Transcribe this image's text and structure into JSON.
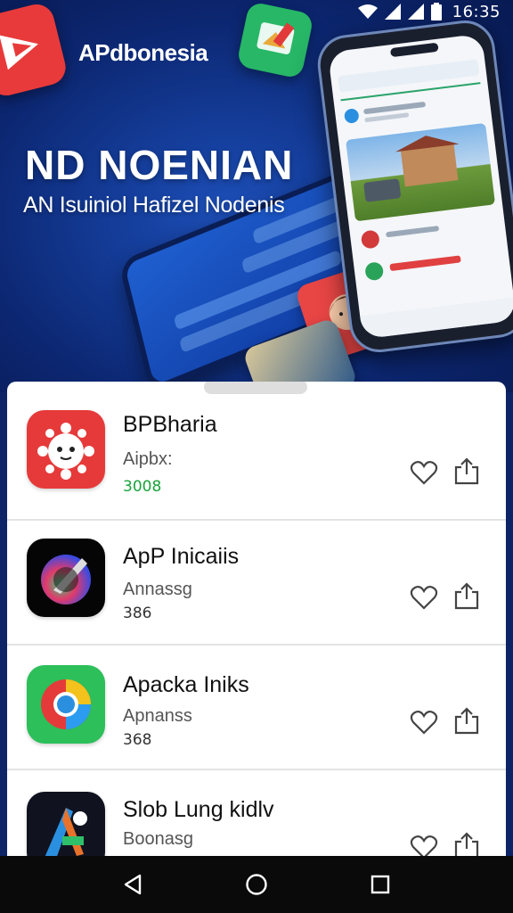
{
  "status_bar": {
    "time": "16:35"
  },
  "header": {
    "title": "APdbonesia"
  },
  "hero": {
    "headline": "ND NOENIAN",
    "subheadline": "AN Isuiniol Hafizel Nodenis"
  },
  "apps": [
    {
      "name": "BPBharia",
      "subtitle": "Aipbx:",
      "count": "3008",
      "count_color": "#1aa33a",
      "icon": "red-mascot-icon"
    },
    {
      "name": "ApP Inicaiis",
      "subtitle": "Annassg",
      "count": "386",
      "count_color": "#333333",
      "icon": "rocket-orb-icon"
    },
    {
      "name": "Apacka Iniks",
      "subtitle": "Apnanss",
      "count": "368",
      "count_color": "#333333",
      "icon": "browser-circle-icon"
    },
    {
      "name": "Slob Lung kidlv",
      "subtitle": "Boonasg",
      "count": "",
      "count_color": "#333333",
      "icon": "art-brush-icon"
    }
  ],
  "colors": {
    "hero_bg": "#143c98",
    "brand_red": "#e83a3a",
    "accent_green": "#1aa33a",
    "navbar": "#0a0a0a"
  }
}
